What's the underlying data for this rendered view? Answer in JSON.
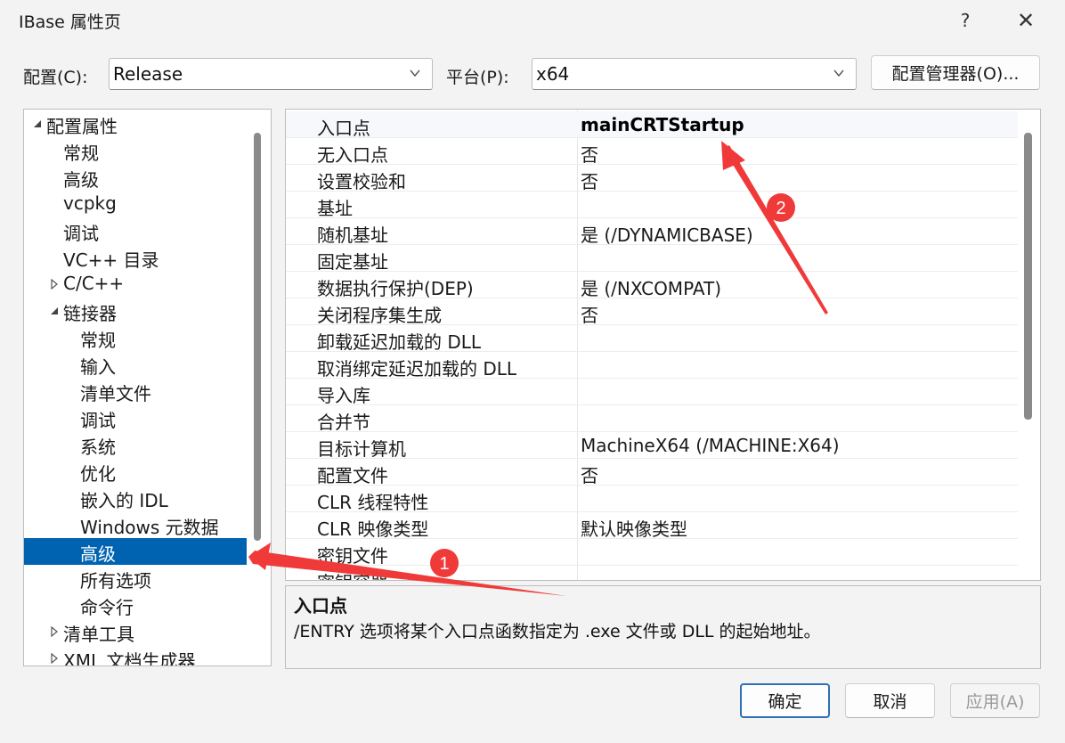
{
  "window": {
    "title": "IBase 属性页",
    "help_label": "?",
    "close_label": "✕"
  },
  "toolbar": {
    "config_label": "配置(C):",
    "config_value": "Release",
    "platform_label": "平台(P):",
    "platform_value": "x64",
    "config_manager_label": "配置管理器(O)..."
  },
  "tree": {
    "items": [
      {
        "label": "配置属性",
        "expander": "expanded",
        "level": 0
      },
      {
        "label": "常规",
        "expander": "none",
        "level": 1
      },
      {
        "label": "高级",
        "expander": "none",
        "level": 1
      },
      {
        "label": "vcpkg",
        "expander": "none",
        "level": 1
      },
      {
        "label": "调试",
        "expander": "none",
        "level": 1
      },
      {
        "label": "VC++ 目录",
        "expander": "none",
        "level": 1
      },
      {
        "label": "C/C++",
        "expander": "collapsed",
        "level": 1
      },
      {
        "label": "链接器",
        "expander": "expanded",
        "level": 1
      },
      {
        "label": "常规",
        "expander": "none",
        "level": 2
      },
      {
        "label": "输入",
        "expander": "none",
        "level": 2
      },
      {
        "label": "清单文件",
        "expander": "none",
        "level": 2
      },
      {
        "label": "调试",
        "expander": "none",
        "level": 2
      },
      {
        "label": "系统",
        "expander": "none",
        "level": 2
      },
      {
        "label": "优化",
        "expander": "none",
        "level": 2
      },
      {
        "label": "嵌入的 IDL",
        "expander": "none",
        "level": 2
      },
      {
        "label": "Windows 元数据",
        "expander": "none",
        "level": 2
      },
      {
        "label": "高级",
        "expander": "none",
        "level": 2,
        "selected": true
      },
      {
        "label": "所有选项",
        "expander": "none",
        "level": 2
      },
      {
        "label": "命令行",
        "expander": "none",
        "level": 2
      },
      {
        "label": "清单工具",
        "expander": "collapsed",
        "level": 1
      },
      {
        "label": "XML 文档生成器",
        "expander": "collapsed",
        "level": 1
      }
    ]
  },
  "grid": {
    "rows": [
      {
        "name": "入口点",
        "value": "mainCRTStartup"
      },
      {
        "name": "无入口点",
        "value": "否"
      },
      {
        "name": "设置校验和",
        "value": "否"
      },
      {
        "name": "基址",
        "value": ""
      },
      {
        "name": "随机基址",
        "value": "是 (/DYNAMICBASE)"
      },
      {
        "name": "固定基址",
        "value": ""
      },
      {
        "name": "数据执行保护(DEP)",
        "value": "是 (/NXCOMPAT)"
      },
      {
        "name": "关闭程序集生成",
        "value": "否"
      },
      {
        "name": "卸载延迟加载的 DLL",
        "value": ""
      },
      {
        "name": "取消绑定延迟加载的 DLL",
        "value": ""
      },
      {
        "name": "导入库",
        "value": ""
      },
      {
        "name": "合并节",
        "value": ""
      },
      {
        "name": "目标计算机",
        "value": "MachineX64 (/MACHINE:X64)"
      },
      {
        "name": "配置文件",
        "value": "否"
      },
      {
        "name": "CLR 线程特性",
        "value": ""
      },
      {
        "name": "CLR 映像类型",
        "value": "默认映像类型"
      },
      {
        "name": "密钥文件",
        "value": ""
      },
      {
        "name": "密钥容器",
        "value": ""
      }
    ]
  },
  "description": {
    "title": "入口点",
    "text": "/ENTRY 选项将某个入口点函数指定为 .exe 文件或 DLL 的起始地址。"
  },
  "buttons": {
    "ok": "确定",
    "cancel": "取消",
    "apply": "应用(A)"
  },
  "annotations": {
    "badge1": "1",
    "badge2": "2",
    "color": "#f03a3a"
  }
}
